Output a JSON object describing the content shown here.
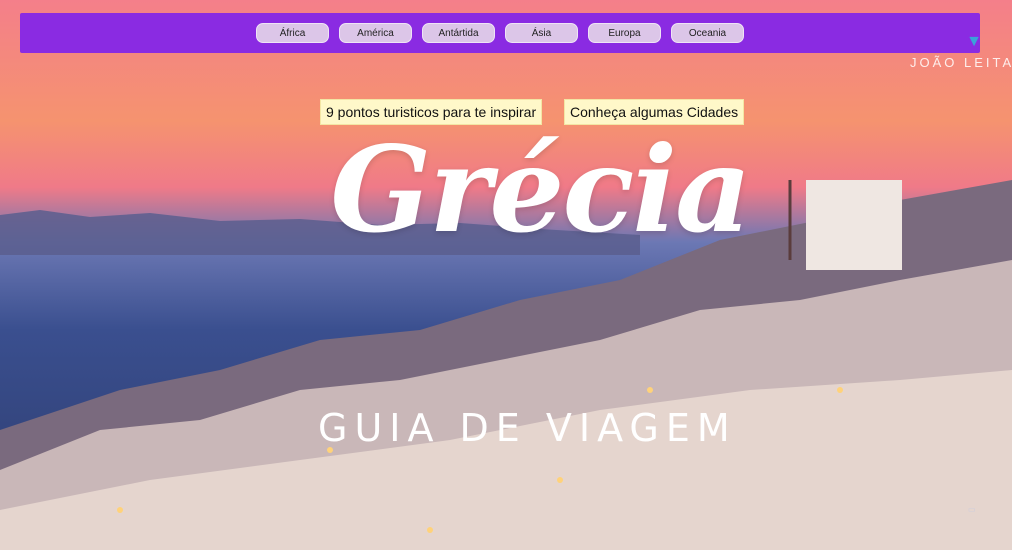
{
  "nav": {
    "continents": [
      "África",
      "América",
      "Antártida",
      "Ásia",
      "Europa",
      "Oceania"
    ]
  },
  "links": {
    "spots": "9 pontos turisticos para te inspirar",
    "cities": "Conheça algumas Cidades"
  },
  "hero": {
    "title": "Grécia",
    "subtitle": "GUIA DE VIAGEM",
    "author": "JOÃO LEITA"
  },
  "colors": {
    "topbar": "#8a2be2",
    "button": "#dcc6e8",
    "link_button": "#fff8c9"
  }
}
